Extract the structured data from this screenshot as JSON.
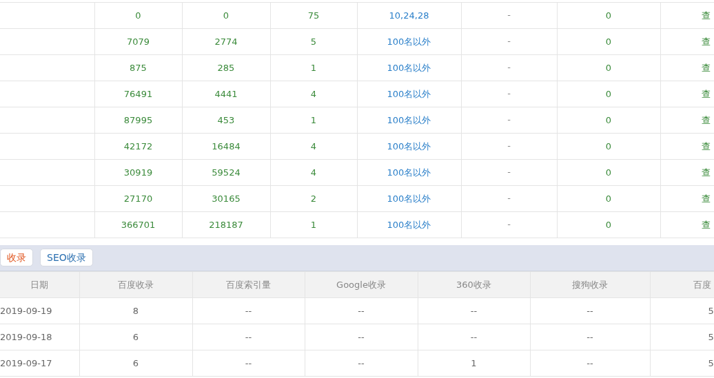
{
  "keyword_table": {
    "rows": [
      {
        "column_2": "0",
        "column_3": "0",
        "column_4": "75",
        "rank": "10,24,28",
        "column_6": "-",
        "column_7": "0",
        "column_8": "查"
      },
      {
        "column_2": "7079",
        "column_3": "2774",
        "column_4": "5",
        "rank": "100名以外",
        "column_6": "-",
        "column_7": "0",
        "column_8": "查"
      },
      {
        "column_2": "875",
        "column_3": "285",
        "column_4": "1",
        "rank": "100名以外",
        "column_6": "-",
        "column_7": "0",
        "column_8": "查"
      },
      {
        "column_2": "76491",
        "column_3": "4441",
        "column_4": "4",
        "rank": "100名以外",
        "column_6": "-",
        "column_7": "0",
        "column_8": "查"
      },
      {
        "column_2": "87995",
        "column_3": "453",
        "column_4": "1",
        "rank": "100名以外",
        "column_6": "-",
        "column_7": "0",
        "column_8": "查"
      },
      {
        "column_2": "42172",
        "column_3": "16484",
        "column_4": "4",
        "rank": "100名以外",
        "column_6": "-",
        "column_7": "0",
        "column_8": "查"
      },
      {
        "column_2": "30919",
        "column_3": "59524",
        "column_4": "4",
        "rank": "100名以外",
        "column_6": "-",
        "column_7": "0",
        "column_8": "查"
      },
      {
        "column_2": "27170",
        "column_3": "30165",
        "column_4": "2",
        "rank": "100名以外",
        "column_6": "-",
        "column_7": "0",
        "column_8": "查"
      },
      {
        "column_2": "366701",
        "column_3": "218187",
        "column_4": "1",
        "rank": "100名以外",
        "column_6": "-",
        "column_7": "0",
        "column_8": "查"
      }
    ]
  },
  "tabs": [
    {
      "label": "收录",
      "selected": true
    },
    {
      "label": "SEO收录",
      "selected": false
    }
  ],
  "index_table": {
    "columns": [
      "日期",
      "百度收录",
      "百度索引量",
      "Google收录",
      "360收录",
      "搜狗收录",
      "百度"
    ],
    "rows": [
      [
        "2019-09-19",
        "8",
        "--",
        "--",
        "--",
        "--",
        "5"
      ],
      [
        "2019-09-18",
        "6",
        "--",
        "--",
        "--",
        "--",
        "5"
      ],
      [
        "2019-09-17",
        "6",
        "--",
        "--",
        "1",
        "--",
        "5"
      ]
    ]
  }
}
